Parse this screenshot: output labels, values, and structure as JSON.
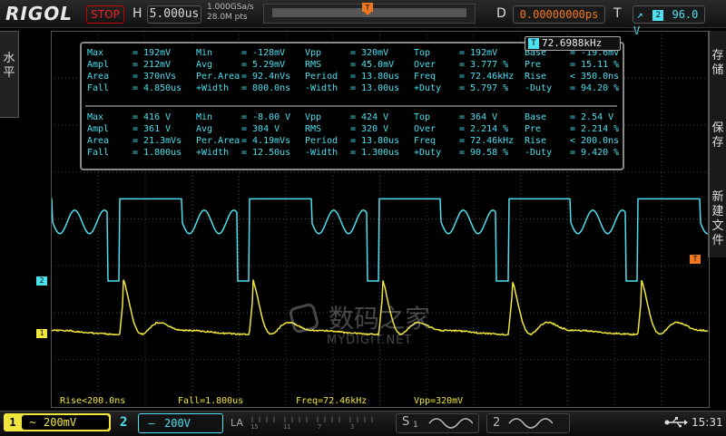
{
  "header": {
    "brand": "RIGOL",
    "run_state": "STOP",
    "h_label": "H",
    "timebase": "5.000us",
    "sample_rate": "1.000GSa/s",
    "memory_depth": "28.0M pts",
    "d_label": "D",
    "delay": "0.00000000ps",
    "t_label": "T",
    "trigger_channel": "2",
    "trigger_level": "96.0 V",
    "trigger_position": 0.5
  },
  "left_menu": {
    "label": "水平"
  },
  "right_menu": {
    "label1": "存储",
    "label2": "保存",
    "label3": "新建文件"
  },
  "freq_tag": {
    "icon": "T",
    "value": "72.6988kHz"
  },
  "measurements": {
    "ch1": [
      [
        "Max",
        "= 192mV",
        "Min",
        "= -128mV",
        "Vpp",
        "= 320mV",
        "Top",
        "= 192mV",
        "Base",
        "= -19.6mV"
      ],
      [
        "Ampl",
        "= 212mV",
        "Avg",
        "= 5.29mV",
        "RMS",
        "= 45.0mV",
        "Over",
        "= 3.777 %",
        "Pre",
        "= 15.11 %"
      ],
      [
        "Area",
        "= 370nVs",
        "Per.Area",
        "= 92.4nVs",
        "Period",
        "= 13.80us",
        "Freq",
        "= 72.46kHz",
        "Rise",
        "< 350.0ns"
      ],
      [
        "Fall",
        "= 4.850us",
        "+Width",
        "= 800.0ns",
        "-Width",
        "= 13.00us",
        "+Duty",
        "= 5.797 %",
        "-Duty",
        "= 94.20 %"
      ]
    ],
    "ch2": [
      [
        "Max",
        "= 416 V",
        "Min",
        "= -8.00 V",
        "Vpp",
        "= 424 V",
        "Top",
        "= 364 V",
        "Base",
        "= 2.54 V"
      ],
      [
        "Ampl",
        "= 361 V",
        "Avg",
        "= 304 V",
        "RMS",
        "= 320 V",
        "Over",
        "= 2.214 %",
        "Pre",
        "= 2.214 %"
      ],
      [
        "Area",
        "= 21.3mVs",
        "Per.Area",
        "= 4.19mVs",
        "Period",
        "= 13.80us",
        "Freq",
        "= 72.46kHz",
        "Rise",
        "< 200.0ns"
      ],
      [
        "Fall",
        "= 1.800us",
        "+Width",
        "= 12.50us",
        "-Width",
        "= 1.300us",
        "+Duty",
        "= 90.58 %",
        "-Duty",
        "= 9.420 %"
      ]
    ]
  },
  "bottom_measurements": {
    "rise": "Rise<200.0ns",
    "fall": "Fall=1.800us",
    "freq": "Freq=72.46kHz",
    "vpp": "Vpp=320mV"
  },
  "watermark": {
    "line1": "数码之家",
    "line2": "MYDIGIT.NET"
  },
  "status": {
    "ch1_num": "1",
    "ch1_coupling": "~",
    "ch1_scale": "200mV",
    "ch2_num": "2",
    "ch2_coupling": "—",
    "ch2_scale": "200V",
    "la_label": "LA",
    "la_ticks": [
      "15",
      "11",
      "7",
      "3"
    ],
    "s1": "S",
    "s1_num": "1",
    "s2_num": "2",
    "time": "15:31"
  },
  "markers": {
    "ch1": "1",
    "ch2": "2",
    "trig": "T"
  },
  "colors": {
    "ch1": "#f0e63c",
    "ch2": "#4ce0f0",
    "accent": "#f07820",
    "stop": "#e22222"
  },
  "chart_data": {
    "type": "line",
    "period_divisions": 2.76,
    "series": [
      {
        "name": "",
        "channel": "2",
        "color": "#4ce0f0",
        "waveform": "square pulse with ringing",
        "high_level_div": 1.75,
        "low_level_div": -1.6,
        "ringing_amplitude_div": 0.25
      },
      {
        "name": "",
        "channel": "1",
        "color": "#f0e63c",
        "waveform": "decaying spike",
        "baseline_div": 0.0,
        "peak_div": 0.8,
        "trough_div": -0.3
      }
    ]
  }
}
